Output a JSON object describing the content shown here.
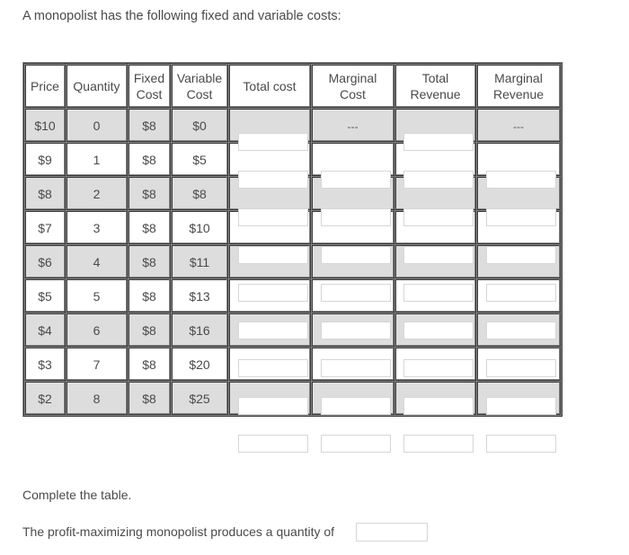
{
  "intro": "A monopolist has the following fixed and variable costs:",
  "table": {
    "headers": {
      "price": "Price",
      "quantity": "Quantity",
      "fixed_cost": [
        "Fixed",
        "Cost"
      ],
      "variable_cost": [
        "Variable",
        "Cost"
      ],
      "total_cost": "Total cost",
      "marginal_cost": [
        "Marginal",
        "Cost"
      ],
      "total_revenue": [
        "Total",
        "Revenue"
      ],
      "marginal_revenue": [
        "Marginal",
        "Revenue"
      ]
    },
    "first_row_placeholder": "---",
    "rows": [
      {
        "price": "$10",
        "quantity": "0",
        "fixed_cost": "$8",
        "variable_cost": "$0"
      },
      {
        "price": "$9",
        "quantity": "1",
        "fixed_cost": "$8",
        "variable_cost": "$5"
      },
      {
        "price": "$8",
        "quantity": "2",
        "fixed_cost": "$8",
        "variable_cost": "$8"
      },
      {
        "price": "$7",
        "quantity": "3",
        "fixed_cost": "$8",
        "variable_cost": "$10"
      },
      {
        "price": "$6",
        "quantity": "4",
        "fixed_cost": "$8",
        "variable_cost": "$11"
      },
      {
        "price": "$5",
        "quantity": "5",
        "fixed_cost": "$8",
        "variable_cost": "$13"
      },
      {
        "price": "$4",
        "quantity": "6",
        "fixed_cost": "$8",
        "variable_cost": "$16"
      },
      {
        "price": "$3",
        "quantity": "7",
        "fixed_cost": "$8",
        "variable_cost": "$20"
      },
      {
        "price": "$2",
        "quantity": "8",
        "fixed_cost": "$8",
        "variable_cost": "$25"
      }
    ],
    "input_values": {
      "total_cost": [
        "",
        "",
        "",
        "",
        "",
        "",
        "",
        "",
        ""
      ],
      "marginal_cost": [
        "",
        "",
        "",
        "",
        "",
        "",
        "",
        ""
      ],
      "total_revenue": [
        "",
        "",
        "",
        "",
        "",
        "",
        "",
        "",
        ""
      ],
      "marginal_revenue": [
        "",
        "",
        "",
        "",
        "",
        "",
        "",
        ""
      ]
    }
  },
  "instruction": "Complete the table.",
  "question": {
    "label": "The profit-maximizing monopolist produces a quantity of",
    "value": ""
  }
}
